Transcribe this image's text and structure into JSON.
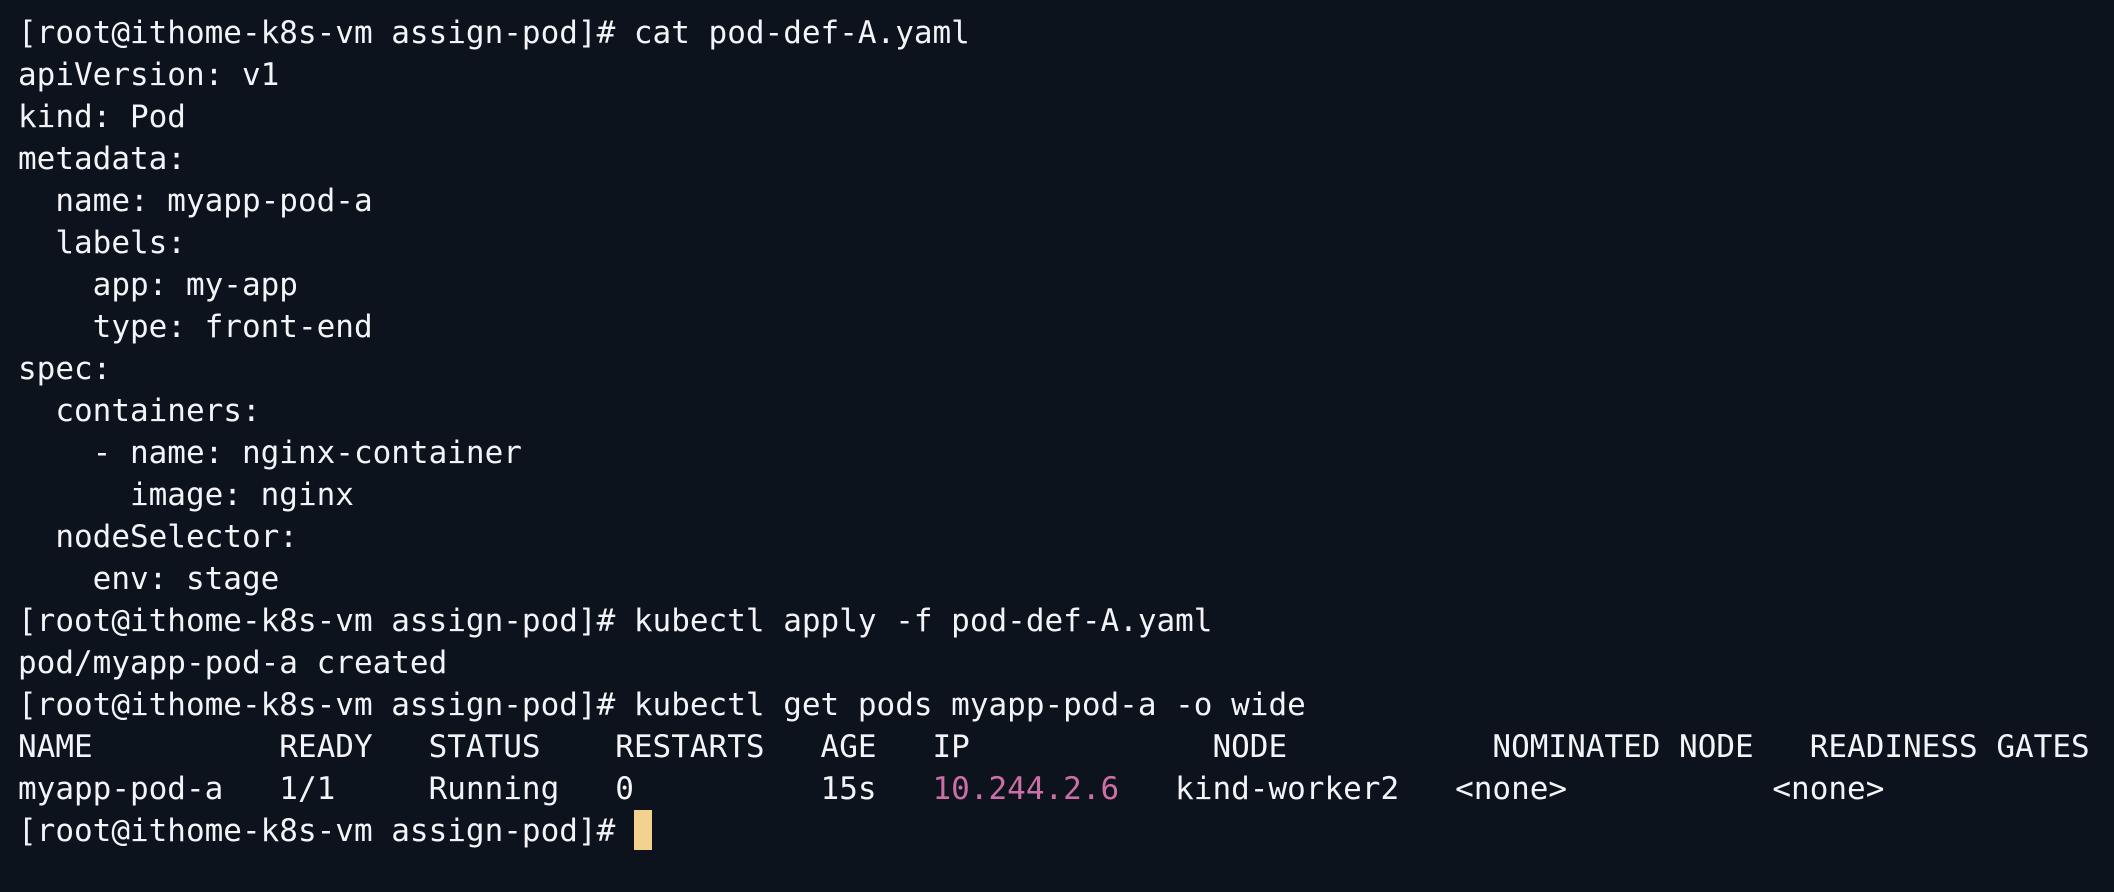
{
  "terminal": {
    "prompt": "[root@ithome-k8s-vm assign-pod]#",
    "colors": {
      "background": "#0d131d",
      "text": "#f2f4f7",
      "ip": "#cc6fa7",
      "cursor": "#f3d18f"
    },
    "lines": [
      "[root@ithome-k8s-vm assign-pod]# cat pod-def-A.yaml",
      "apiVersion: v1",
      "kind: Pod",
      "metadata:",
      "  name: myapp-pod-a",
      "  labels:",
      "    app: my-app",
      "    type: front-end",
      "spec:",
      "  containers:",
      "    - name: nginx-container",
      "      image: nginx",
      "  nodeSelector:",
      "    env: stage",
      "[root@ithome-k8s-vm assign-pod]# kubectl apply -f pod-def-A.yaml",
      "pod/myapp-pod-a created",
      "[root@ithome-k8s-vm assign-pod]# kubectl get pods myapp-pod-a -o wide",
      "NAME          READY   STATUS    RESTARTS   AGE   IP             NODE           NOMINATED NODE   READINESS GATES"
    ],
    "result_row": {
      "before_ip": "myapp-pod-a   1/1     Running   0          15s   ",
      "ip": "10.244.2.6",
      "after_ip": "   kind-worker2   <none>           <none>"
    }
  }
}
